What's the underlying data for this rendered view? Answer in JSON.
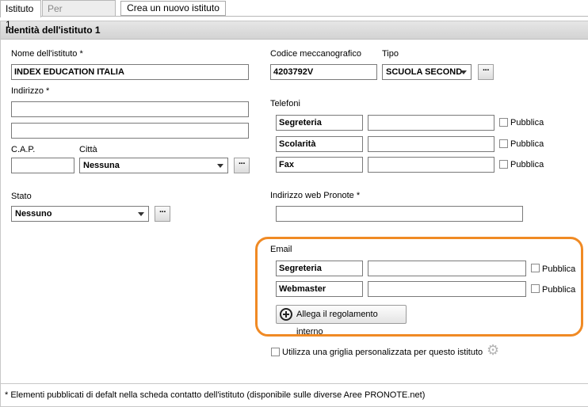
{
  "tabs": {
    "active": "Istituto 1",
    "inactive": "Per connessione",
    "new_button": "Crea un nuovo istituto"
  },
  "panel": {
    "title": "Identità dell'istituto 1"
  },
  "form": {
    "name_label": "Nome dell'istituto *",
    "name_value": "INDEX EDUCATION ITALIA",
    "address_label": "Indirizzo *",
    "address_line1": "",
    "address_line2": "",
    "cap_label": "C.A.P.",
    "cap_value": "",
    "city_label": "Città",
    "city_value": "Nessuna",
    "state_label": "Stato",
    "state_value": "Nessuno",
    "code_label": "Codice meccanografico",
    "code_value": "4203792V",
    "type_label": "Tipo",
    "type_value": "SCUOLA SECOND",
    "phones_label": "Telefoni",
    "phones": [
      {
        "name": "Segreteria",
        "value": "",
        "publish": "Pubblica"
      },
      {
        "name": "Scolarità",
        "value": "",
        "publish": "Pubblica"
      },
      {
        "name": "Fax",
        "value": "",
        "publish": "Pubblica"
      }
    ],
    "web_label": "Indirizzo web Pronote *",
    "web_value": "",
    "email_label": "Email",
    "emails": [
      {
        "name": "Segreteria",
        "value": "",
        "publish": "Pubblica"
      },
      {
        "name": "Webmaster",
        "value": "",
        "publish": "Pubblica"
      }
    ],
    "attach_label": "Allega il regolamento interno",
    "grid_label": "Utilizza una griglia personalizzata per questo istituto",
    "dots": "···"
  },
  "footer": {
    "note": "* Elementi pubblicati di defalt nella scheda contatto dell'istituto (disponibile sulle diverse Aree PRONOTE.net)"
  },
  "colors": {
    "highlight": "#f08a24"
  },
  "icons": {
    "attach": "plus-circle-icon",
    "settings": "gear-icon",
    "dropdown": "chevron-down-icon"
  }
}
